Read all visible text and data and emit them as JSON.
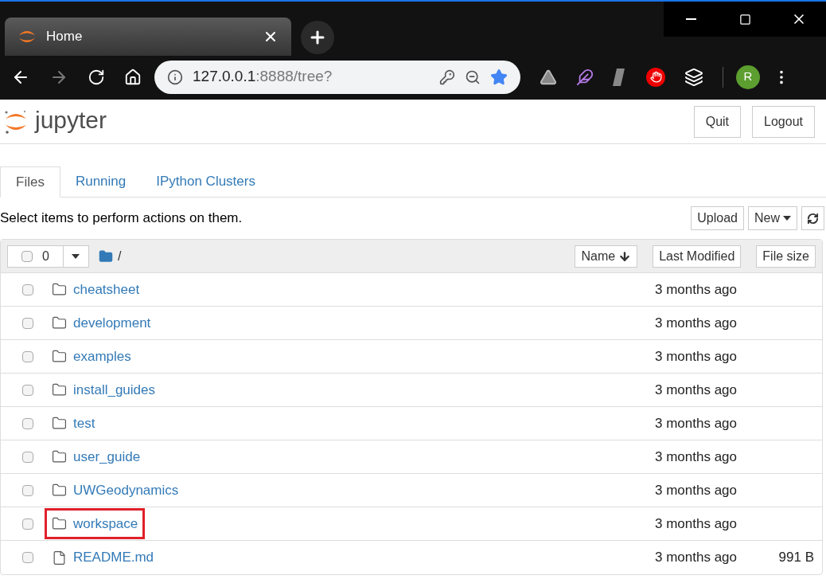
{
  "browser": {
    "tab": {
      "title": "Home",
      "selected": true
    },
    "url": {
      "host": "127.0.0.1",
      "path": ":8888/tree?"
    },
    "bookmarked": true,
    "profile_initial": "R"
  },
  "header": {
    "app_name": "jupyter",
    "buttons": [
      "Quit",
      "Logout"
    ]
  },
  "tabs": [
    {
      "label": "Files",
      "selected": true
    },
    {
      "label": "Running",
      "selected": false
    },
    {
      "label": "IPython Clusters",
      "selected": false
    }
  ],
  "hint": "Select items to perform actions on them.",
  "actions": {
    "upload": "Upload",
    "new": "New"
  },
  "list_header": {
    "all_checked": false,
    "selected_count": "0",
    "path": "/",
    "sort_buttons": [
      "Name",
      "Last Modified",
      "File size"
    ]
  },
  "rows": [
    {
      "kind": "folder",
      "name": "cheatsheet",
      "modified": "3 months ago",
      "highlighted": false,
      "checked": false
    },
    {
      "kind": "folder",
      "name": "development",
      "modified": "3 months ago",
      "highlighted": false,
      "checked": false
    },
    {
      "kind": "folder",
      "name": "examples",
      "modified": "3 months ago",
      "highlighted": false,
      "checked": false
    },
    {
      "kind": "folder",
      "name": "install_guides",
      "modified": "3 months ago",
      "highlighted": false,
      "checked": false
    },
    {
      "kind": "folder",
      "name": "test",
      "modified": "3 months ago",
      "highlighted": false,
      "checked": false
    },
    {
      "kind": "folder",
      "name": "user_guide",
      "modified": "3 months ago",
      "highlighted": false,
      "checked": false
    },
    {
      "kind": "folder",
      "name": "UWGeodynamics",
      "modified": "3 months ago",
      "highlighted": false,
      "checked": false
    },
    {
      "kind": "folder",
      "name": "workspace",
      "modified": "3 months ago",
      "highlighted": true,
      "checked": false
    },
    {
      "kind": "file",
      "name": "README.md",
      "modified": "3 months ago",
      "size": "991 B",
      "highlighted": false,
      "checked": false
    }
  ]
}
